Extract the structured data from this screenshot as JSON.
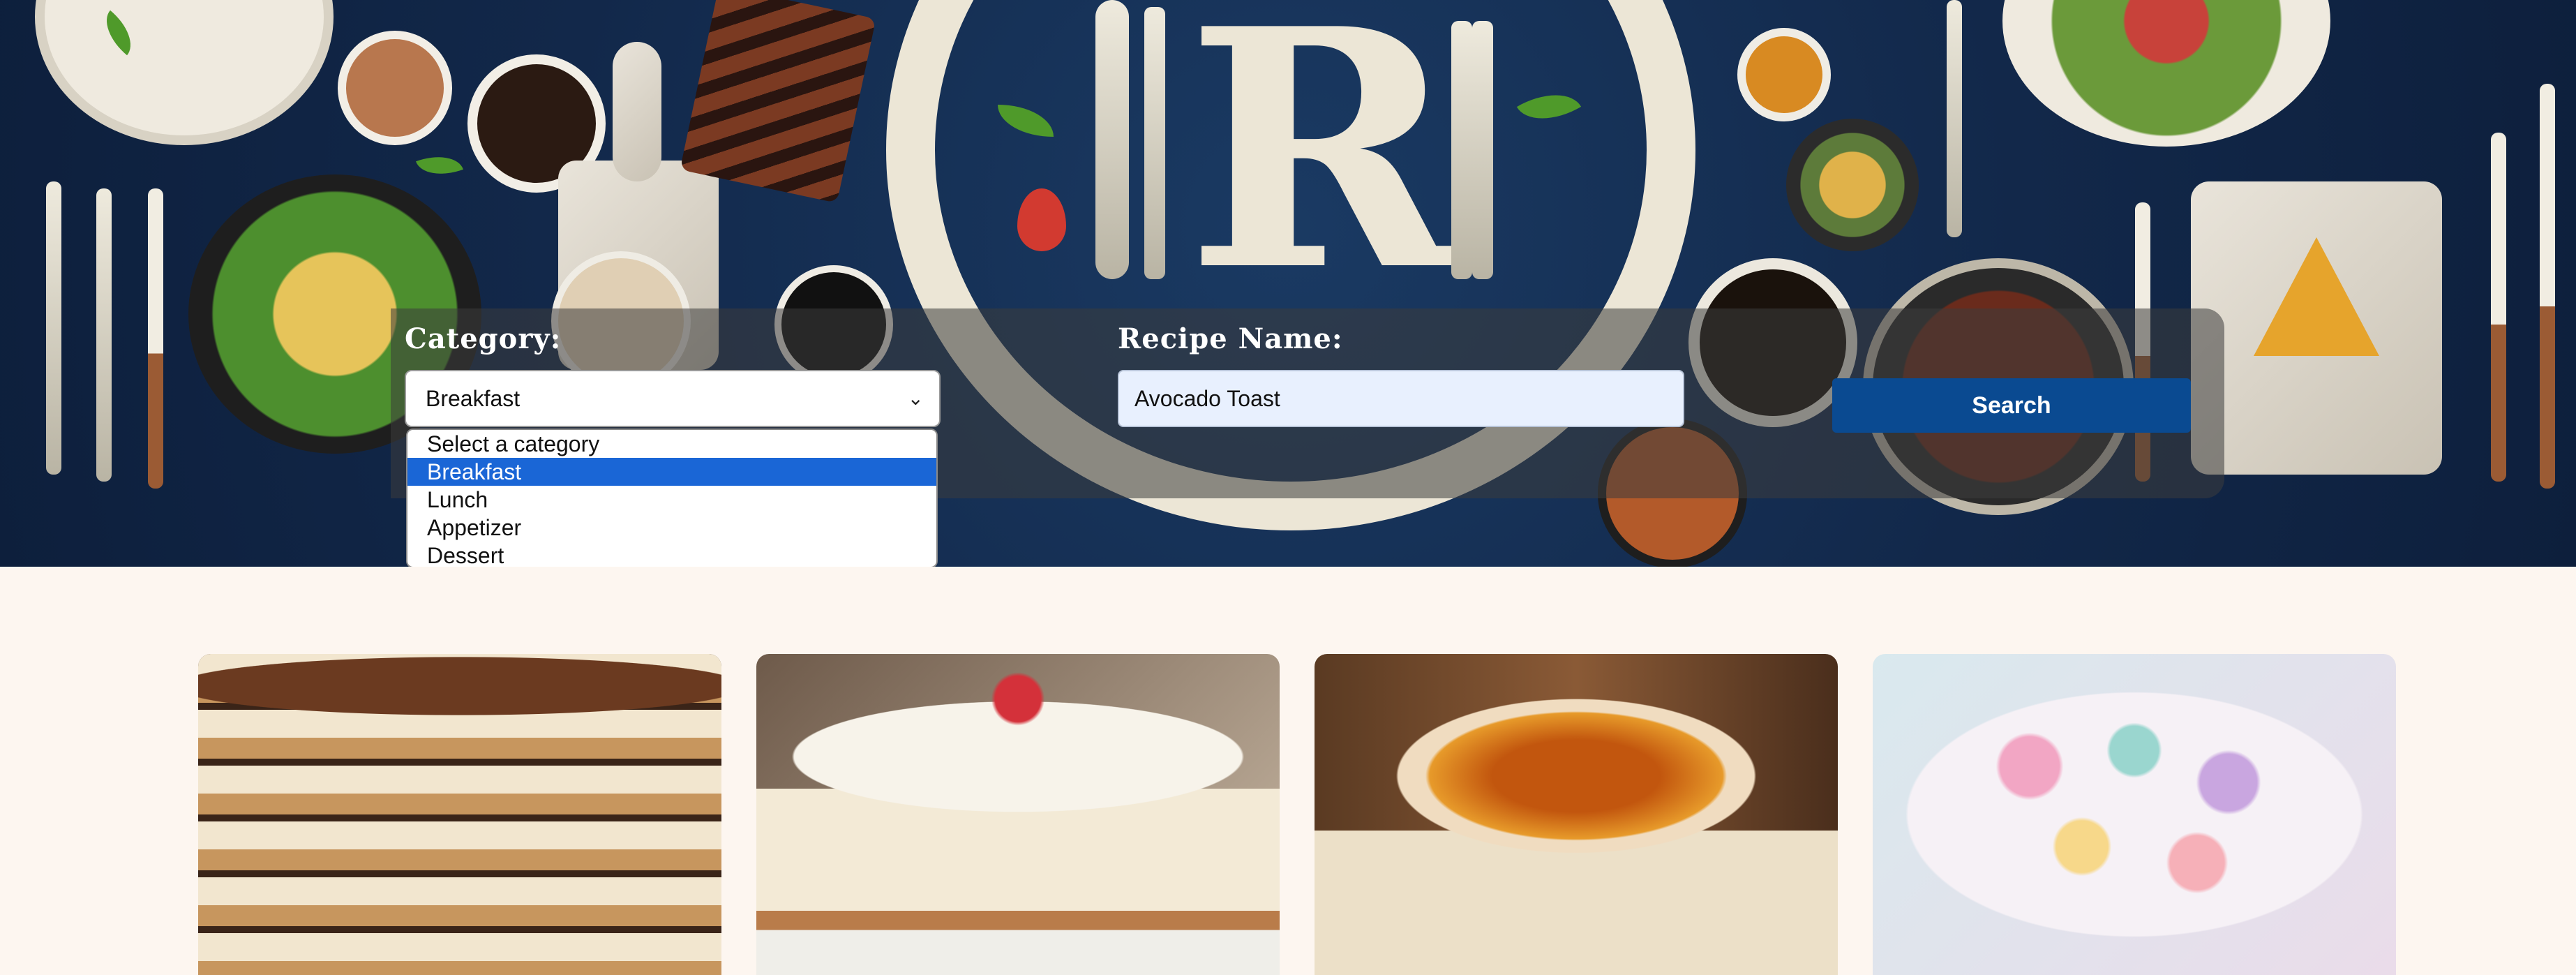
{
  "hero": {
    "logo_letter": "R",
    "colors": {
      "background": "#12284a",
      "ring": "#ece6d6",
      "band": "rgba(60,60,60,0.55)"
    }
  },
  "search": {
    "category_label": "Category:",
    "category_selected": "Breakfast",
    "category_options": [
      "Select a category",
      "Breakfast",
      "Lunch",
      "Appetizer",
      "Dessert"
    ],
    "selected_index": 1,
    "recipe_label": "Recipe Name:",
    "recipe_value": "Avocado Toast",
    "search_label": "Search",
    "colors": {
      "button": "#0a4a91",
      "highlight": "#1a66d6"
    }
  },
  "cards": [
    {
      "dish_icon": "tiramisu-image"
    },
    {
      "dish_icon": "cheesecake-image"
    },
    {
      "dish_icon": "creme-brulee-image"
    },
    {
      "dish_icon": "macarons-image"
    }
  ],
  "page": {
    "background": "#fdf6f0"
  }
}
